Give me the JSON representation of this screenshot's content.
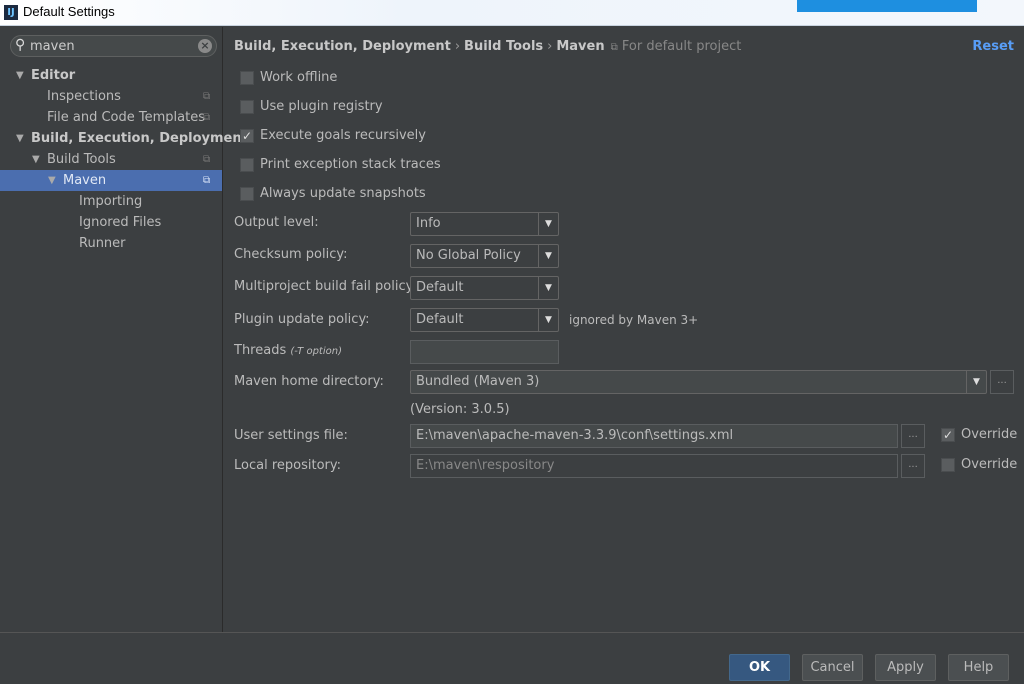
{
  "window": {
    "title": "Default Settings"
  },
  "search": {
    "value": "maven"
  },
  "tree": [
    {
      "label": "Editor",
      "level": 0,
      "expanded": true,
      "bold": true
    },
    {
      "label": "Inspections",
      "level": 1,
      "copy": true
    },
    {
      "label": "File and Code Templates",
      "level": 1,
      "copy": true
    },
    {
      "label": "Build, Execution, Deployment",
      "level": 0,
      "expanded": true,
      "bold": true
    },
    {
      "label": "Build Tools",
      "level": 1,
      "expanded": true,
      "copy": true
    },
    {
      "label": "Maven",
      "level": 1.5,
      "expanded": true,
      "selected": true,
      "copy": true
    },
    {
      "label": "Importing",
      "level": 2
    },
    {
      "label": "Ignored Files",
      "level": 2
    },
    {
      "label": "Runner",
      "level": 2
    }
  ],
  "breadcrumb": {
    "items": [
      "Build, Execution, Deployment",
      "Build Tools",
      "Maven"
    ],
    "scope": "For default project"
  },
  "reset_label": "Reset",
  "checkboxes": [
    {
      "label": "Work offline",
      "checked": false
    },
    {
      "label": "Use plugin registry",
      "checked": false
    },
    {
      "label": "Execute goals recursively",
      "checked": true
    },
    {
      "label": "Print exception stack traces",
      "checked": false
    },
    {
      "label": "Always update snapshots",
      "checked": false
    }
  ],
  "form": {
    "output_level": {
      "label": "Output level:",
      "value": "Info"
    },
    "checksum_policy": {
      "label": "Checksum policy:",
      "value": "No Global Policy"
    },
    "fail_policy": {
      "label": "Multiproject build fail policy:",
      "value": "Default"
    },
    "plugin_update": {
      "label": "Plugin update policy:",
      "value": "Default",
      "note": "ignored by Maven 3+"
    },
    "threads": {
      "label": "Threads",
      "hint": "(-T option)",
      "value": ""
    },
    "maven_home": {
      "label": "Maven home directory:",
      "value": "Bundled (Maven 3)",
      "version": "(Version: 3.0.5)"
    },
    "user_settings": {
      "label": "User settings file:",
      "value": "E:\\maven\\apache-maven-3.3.9\\conf\\settings.xml",
      "override_label": "Override",
      "override": true
    },
    "local_repo": {
      "label": "Local repository:",
      "value": "E:\\maven\\respository",
      "override_label": "Override",
      "override": false
    }
  },
  "browse_label": "...",
  "buttons": {
    "ok": "OK",
    "cancel": "Cancel",
    "apply": "Apply",
    "help": "Help"
  }
}
